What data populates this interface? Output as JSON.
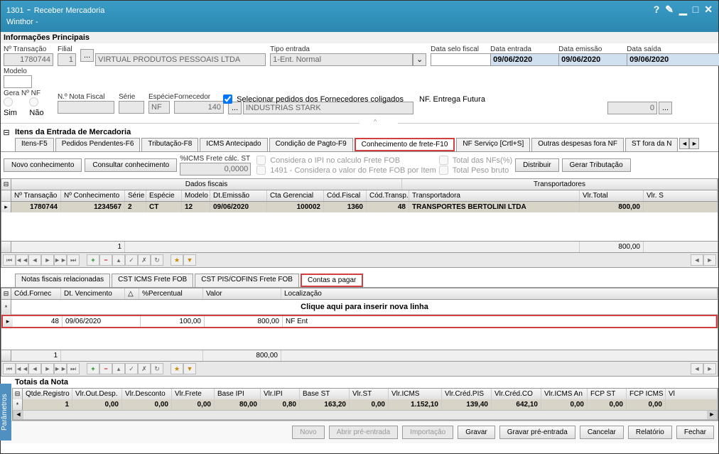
{
  "titlebar": {
    "code": "1301",
    "title": "Receber Mercadoria",
    "subtitle": "Winthor -"
  },
  "info_principal": {
    "section_label": "Informações Principais",
    "num_transacao_label": "Nº Transação",
    "num_transacao": "1780744",
    "filial_label": "Filial",
    "filial": "1",
    "fornecedor_nome": "VIRTUAL PRODUTOS PESSOAIS LTDA",
    "tipo_entrada_label": "Tipo entrada",
    "tipo_entrada": "1-Ent. Normal",
    "data_selo_label": "Data selo fiscal",
    "data_entrada_label": "Data entrada",
    "data_entrada": "09/06/2020",
    "data_emissao_label": "Data emissão",
    "data_emissao": "09/06/2020",
    "data_saida_label": "Data saída",
    "data_saida": "09/06/2020",
    "modelo_label": "Modelo",
    "gera_nf_label": "Gera Nº NF",
    "sim_label": "Sim",
    "nao_label": "Não",
    "num_nota_label": "N.º Nota Fiscal",
    "serie_label": "Série",
    "especie_label": "Espécie",
    "especie": "NF",
    "fornecedor_label": "Fornecedor",
    "fornecedor_cod": "140",
    "fornecedor_desc": "INDUSTRIAS STARK",
    "selecionar_pedidos": "Selecionar pedidos dos Fornecedores coligados",
    "nf_entrega": "NF. Entrega Futura",
    "valor_zero": "0"
  },
  "itens_section": {
    "label": "Itens da Entrada de Mercadoria",
    "tabs": [
      "Itens-F5",
      "Pedidos Pendentes-F6",
      "Tributação-F8",
      "ICMS Antecipado",
      "Condição de Pagto-F9",
      "Conhecimento de frete-F10",
      "NF Serviço [Crtl+S]",
      "Outras despesas fora NF",
      "ST fora da N"
    ],
    "btn_novo": "Novo conhecimento",
    "btn_consultar": "Consultar conhecimento",
    "icms_frete_label": "%ICMS Frete cálc. ST",
    "icms_frete_val": "0,0000",
    "chk_ipi": "Considera o IPI no calculo Frete FOB",
    "chk_1491": "1491 - Considera o valor do Frete FOB por Item",
    "chk_total_nf": "Total das NFs(%)",
    "chk_total_peso": "Total Peso bruto",
    "btn_distribuir": "Distribuir",
    "btn_gerar": "Gerar Tributação"
  },
  "grid1": {
    "group_dados": "Dados fiscais",
    "group_transp": "Transportadores",
    "cols": [
      "Nº Transação",
      "Nº Conhecimento",
      "Série",
      "Espécie",
      "Modelo",
      "Dt.Emissão",
      "Cta Gerencial",
      "Cód.Fiscal",
      "Cód.Transp.",
      "Transportadora",
      "Vlr.Total",
      "Vlr. S"
    ],
    "row": {
      "num_transacao": "1780744",
      "num_conhec": "1234567",
      "serie": "2",
      "especie": "CT",
      "modelo": "12",
      "dt_emissao": "09/06/2020",
      "cta_gerencial": "100002",
      "cod_fiscal": "1360",
      "cod_transp": "48",
      "transportadora": "TRANSPORTES BERTOLINI LTDA",
      "vlr_total": "800,00"
    },
    "summary_count": "1",
    "summary_total": "800,00"
  },
  "subtabs": [
    "Notas fiscais relacionadas",
    "CST ICMS Frete FOB",
    "CST PIS/COFINS Frete FOB",
    "Contas a pagar"
  ],
  "grid2": {
    "cols": [
      "Cód.Fornec",
      "Dt. Vencimento",
      "△",
      "%Percentual",
      "Valor",
      "Localização"
    ],
    "insert_hint": "Clique aqui para inserir nova linha",
    "row": {
      "cod_fornec": "48",
      "dt_venc": "09/06/2020",
      "percentual": "100,00",
      "valor": "800,00",
      "localizacao": "NF Ent"
    },
    "summary_count": "1",
    "summary_valor": "800,00"
  },
  "totals": {
    "label": "Totais da Nota",
    "cols": [
      "Qtde.Registro",
      "Vlr.Out.Desp.",
      "Vlr.Desconto",
      "Vlr.Frete",
      "Base IPI",
      "Vlr.IPI",
      "Base ST",
      "Vlr.ST",
      "Vlr.ICMS",
      "Vlr.Créd.PIS",
      "Vlr.Créd.CO",
      "Vlr.ICMS An",
      "FCP ST",
      "FCP ICMS",
      "Vl"
    ],
    "row": [
      "1",
      "0,00",
      "0,00",
      "0,00",
      "80,00",
      "0,80",
      "163,20",
      "0,00",
      "1.152,10",
      "139,40",
      "642,10",
      "0,00",
      "0,00",
      "0,00"
    ]
  },
  "bottom": {
    "novo": "Novo",
    "abrir": "Abrir pré-entrada",
    "importacao": "Importação",
    "gravar": "Gravar",
    "gravar_pre": "Gravar pré-entrada",
    "cancelar": "Cancelar",
    "relatorio": "Relatório",
    "fechar": "Fechar"
  },
  "sidebar": "Parâmetros"
}
